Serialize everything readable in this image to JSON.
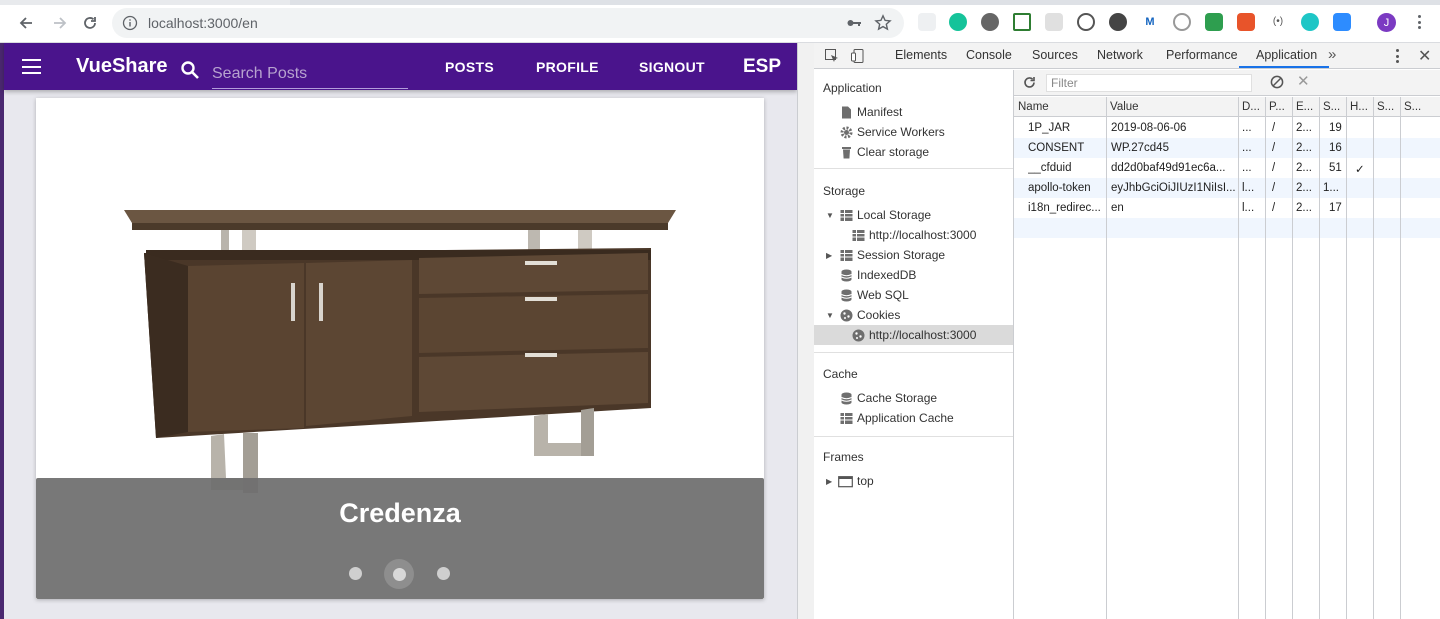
{
  "browser": {
    "url": "localhost:3000/en",
    "avatar_letter": "J",
    "accent": "#1a73e8"
  },
  "app": {
    "brand": "VueShare",
    "search_placeholder": "Search Posts",
    "nav": [
      "POSTS",
      "PROFILE",
      "SIGNOUT"
    ],
    "lang": "ESP",
    "bar_color": "#4a148c"
  },
  "carousel": {
    "caption": "Credenza",
    "dots": 3,
    "active_index": 1
  },
  "devtools": {
    "tabs": [
      "Elements",
      "Console",
      "Sources",
      "Network",
      "Performance",
      "Application"
    ],
    "active_tab": "Application",
    "sidebar": {
      "application_title": "Application",
      "application_items": [
        "Manifest",
        "Service Workers",
        "Clear storage"
      ],
      "storage_title": "Storage",
      "local_storage": "Local Storage",
      "local_storage_child": "http://localhost:3000",
      "session_storage": "Session Storage",
      "indexeddb": "IndexedDB",
      "websql": "Web SQL",
      "cookies": "Cookies",
      "cookies_child": "http://localhost:3000",
      "cache_title": "Cache",
      "cache_items": [
        "Cache Storage",
        "Application Cache"
      ],
      "frames_title": "Frames",
      "frames_top": "top"
    },
    "filter_placeholder": "Filter",
    "columns": [
      "Name",
      "Value",
      "D...",
      "P...",
      "E...",
      "S...",
      "H...",
      "S...",
      "S..."
    ],
    "rows": [
      {
        "name": "1P_JAR",
        "value": "2019-08-06-06",
        "d": "...",
        "p": "/",
        "e": "2...",
        "s": "19",
        "h": ""
      },
      {
        "name": "CONSENT",
        "value": "WP.27cd45",
        "d": "...",
        "p": "/",
        "e": "2...",
        "s": "16",
        "h": ""
      },
      {
        "name": "__cfduid",
        "value": "dd2d0baf49d91ec6a...",
        "d": "...",
        "p": "/",
        "e": "2...",
        "s": "51",
        "h": "✓"
      },
      {
        "name": "apollo-token",
        "value": "eyJhbGciOiJIUzI1NiIsI...",
        "d": "l...",
        "p": "/",
        "e": "2...",
        "s": "1...",
        "h": ""
      },
      {
        "name": "i18n_redirec...",
        "value": "en",
        "d": "l...",
        "p": "/",
        "e": "2...",
        "s": "17",
        "h": ""
      }
    ]
  }
}
